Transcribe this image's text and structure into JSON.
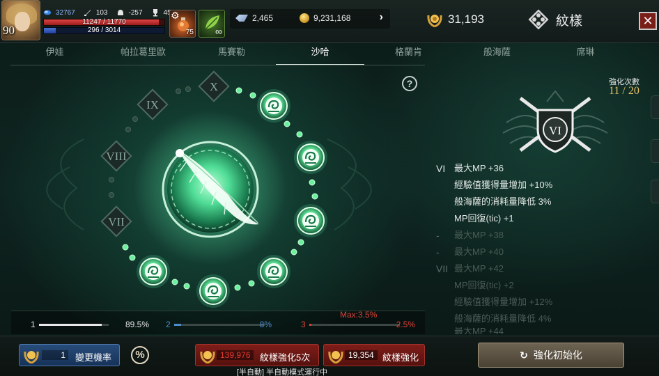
{
  "player": {
    "level": "90",
    "power": "32767",
    "attack": "103",
    "defense": "-257",
    "trophy": "45",
    "hp_text": "11247 / 11770",
    "hp_ratio": 0.955,
    "mp_text": "296 / 3014",
    "mp_ratio": 0.098
  },
  "quick_slots": {
    "potion_count": "75",
    "leaf_count": "∞"
  },
  "resources": {
    "crystal": "2,465",
    "gold": "9,231,168",
    "arrow": "›"
  },
  "laurel_total": "31,193",
  "window_title": "紋樣",
  "close_label": "✕",
  "tabs": [
    {
      "label": "伊娃",
      "active": false
    },
    {
      "label": "帕拉葛里歐",
      "active": false
    },
    {
      "label": "馬賽勒",
      "active": false
    },
    {
      "label": "沙哈",
      "active": true
    },
    {
      "label": "格蘭肯",
      "active": false
    },
    {
      "label": "般海薩",
      "active": false
    },
    {
      "label": "席琳",
      "active": false
    }
  ],
  "wheel": {
    "help": "?",
    "locked_numerals": [
      "X",
      "IX",
      "VIII",
      "VII"
    ]
  },
  "enhance": {
    "label": "強化次數",
    "count": "11 / 20",
    "crest_numeral": "VI"
  },
  "effects": [
    {
      "roman": "VI",
      "lines": [
        "最大MP +36",
        "經驗值獲得量增加 +10%",
        "般海薩的消耗量降低 3%",
        "MP回復(tic) +1"
      ]
    },
    {
      "roman": "-",
      "lines": [
        "最大MP +38",
        "最大MP +40"
      ]
    },
    {
      "roman": "VII",
      "lines": [
        "最大MP +42",
        "MP回復(tic) +2",
        "經驗值獲得量增加 +12%",
        "般海薩的消耗量降低 4%",
        "最大MP +44"
      ]
    }
  ],
  "rates": [
    {
      "index": "1",
      "value": "89.5%",
      "fraction": 0.895,
      "color": "#e8e8e8"
    },
    {
      "index": "2",
      "value": "8%",
      "fraction": 0.08,
      "color": "#4d8ccc"
    },
    {
      "index": "3",
      "value": "2.5%",
      "fraction": 0.025,
      "color": "#d8423a",
      "max": "Max:3.5%"
    }
  ],
  "bottom": {
    "chance_qty": "1",
    "chance_label": "變更機率",
    "percent_icon": "%",
    "enh5_cost": "139,976",
    "enh5_label": "紋樣強化5次",
    "enh1_cost": "19,354",
    "enh1_label": "紋樣強化",
    "reset_label": "強化初始化",
    "reset_icon": "↻",
    "auto_status": "[半自動] 半自動模式運行中"
  },
  "colors": {
    "accent_green": "#4fdc95",
    "gold": "#e6c46a",
    "red_button": "#7e1d18",
    "blue_button": "#284c7a"
  }
}
